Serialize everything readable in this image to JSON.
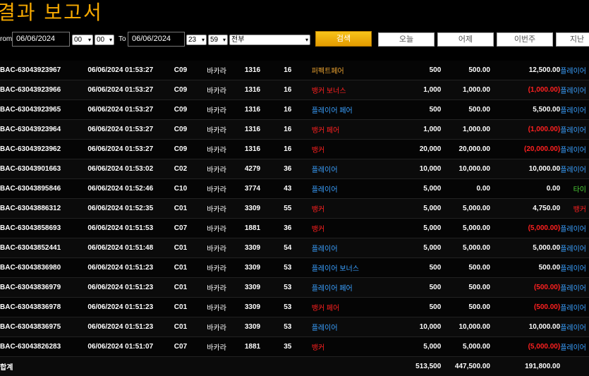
{
  "page": {
    "title": "결과 보고서"
  },
  "filters": {
    "from_label": "rom",
    "from_date": "06/06/2024",
    "from_hour": "00",
    "from_minute": "00",
    "to_label": "To",
    "to_date": "06/06/2024",
    "to_hour": "23",
    "to_minute": "59",
    "type_select": "전부",
    "search_label": "검색",
    "quick": [
      "오늘",
      "어제",
      "이번주",
      "지난"
    ]
  },
  "colors": {
    "orange": "#e8a030",
    "red": "#ff2020",
    "blue": "#3aa0ff",
    "green": "#4cd137",
    "title": "#f5a800"
  },
  "rows": [
    {
      "id": "BAC-63043923967",
      "time": "06/06/2024 01:53:27",
      "table": "C09",
      "game": "바카라",
      "shoe": "1316",
      "round": "16",
      "bet": "퍼펙트페어",
      "bet_color": "orange",
      "amount": "500",
      "valid": "500.00",
      "winloss": "12,500.00",
      "wl_color": "white",
      "result": "플레이어",
      "res_color": "blue"
    },
    {
      "id": "BAC-63043923966",
      "time": "06/06/2024 01:53:27",
      "table": "C09",
      "game": "바카라",
      "shoe": "1316",
      "round": "16",
      "bet": "뱅커 보너스",
      "bet_color": "red",
      "amount": "1,000",
      "valid": "1,000.00",
      "winloss": "(1,000.00)",
      "wl_color": "red",
      "result": "플레이어",
      "res_color": "blue"
    },
    {
      "id": "BAC-63043923965",
      "time": "06/06/2024 01:53:27",
      "table": "C09",
      "game": "바카라",
      "shoe": "1316",
      "round": "16",
      "bet": "플레이어 페어",
      "bet_color": "blue",
      "amount": "500",
      "valid": "500.00",
      "winloss": "5,500.00",
      "wl_color": "white",
      "result": "플레이어",
      "res_color": "blue"
    },
    {
      "id": "BAC-63043923964",
      "time": "06/06/2024 01:53:27",
      "table": "C09",
      "game": "바카라",
      "shoe": "1316",
      "round": "16",
      "bet": "뱅커 페어",
      "bet_color": "red",
      "amount": "1,000",
      "valid": "1,000.00",
      "winloss": "(1,000.00)",
      "wl_color": "red",
      "result": "플레이어",
      "res_color": "blue"
    },
    {
      "id": "BAC-63043923962",
      "time": "06/06/2024 01:53:27",
      "table": "C09",
      "game": "바카라",
      "shoe": "1316",
      "round": "16",
      "bet": "뱅커",
      "bet_color": "red",
      "amount": "20,000",
      "valid": "20,000.00",
      "winloss": "(20,000.00)",
      "wl_color": "red",
      "result": "플레이어",
      "res_color": "blue"
    },
    {
      "id": "BAC-63043901663",
      "time": "06/06/2024 01:53:02",
      "table": "C02",
      "game": "바카라",
      "shoe": "4279",
      "round": "36",
      "bet": "플레이어",
      "bet_color": "blue",
      "amount": "10,000",
      "valid": "10,000.00",
      "winloss": "10,000.00",
      "wl_color": "white",
      "result": "플레이어",
      "res_color": "blue"
    },
    {
      "id": "BAC-63043895846",
      "time": "06/06/2024 01:52:46",
      "table": "C10",
      "game": "바카라",
      "shoe": "3774",
      "round": "43",
      "bet": "플레이어",
      "bet_color": "blue",
      "amount": "5,000",
      "valid": "0.00",
      "winloss": "0.00",
      "wl_color": "white",
      "result": "타이",
      "res_color": "green"
    },
    {
      "id": "BAC-63043886312",
      "time": "06/06/2024 01:52:35",
      "table": "C01",
      "game": "바카라",
      "shoe": "3309",
      "round": "55",
      "bet": "뱅커",
      "bet_color": "red",
      "amount": "5,000",
      "valid": "5,000.00",
      "winloss": "4,750.00",
      "wl_color": "white",
      "result": "뱅커",
      "res_color": "red"
    },
    {
      "id": "BAC-63043858693",
      "time": "06/06/2024 01:51:53",
      "table": "C07",
      "game": "바카라",
      "shoe": "1881",
      "round": "36",
      "bet": "뱅커",
      "bet_color": "red",
      "amount": "5,000",
      "valid": "5,000.00",
      "winloss": "(5,000.00)",
      "wl_color": "red",
      "result": "플레이어",
      "res_color": "blue"
    },
    {
      "id": "BAC-63043852441",
      "time": "06/06/2024 01:51:48",
      "table": "C01",
      "game": "바카라",
      "shoe": "3309",
      "round": "54",
      "bet": "플레이어",
      "bet_color": "blue",
      "amount": "5,000",
      "valid": "5,000.00",
      "winloss": "5,000.00",
      "wl_color": "white",
      "result": "플레이어",
      "res_color": "blue"
    },
    {
      "id": "BAC-63043836980",
      "time": "06/06/2024 01:51:23",
      "table": "C01",
      "game": "바카라",
      "shoe": "3309",
      "round": "53",
      "bet": "플레이어 보너스",
      "bet_color": "blue",
      "amount": "500",
      "valid": "500.00",
      "winloss": "500.00",
      "wl_color": "white",
      "result": "플레이어",
      "res_color": "blue"
    },
    {
      "id": "BAC-63043836979",
      "time": "06/06/2024 01:51:23",
      "table": "C01",
      "game": "바카라",
      "shoe": "3309",
      "round": "53",
      "bet": "플레이어 페어",
      "bet_color": "blue",
      "amount": "500",
      "valid": "500.00",
      "winloss": "(500.00)",
      "wl_color": "red",
      "result": "플레이어",
      "res_color": "blue"
    },
    {
      "id": "BAC-63043836978",
      "time": "06/06/2024 01:51:23",
      "table": "C01",
      "game": "바카라",
      "shoe": "3309",
      "round": "53",
      "bet": "뱅커 페어",
      "bet_color": "red",
      "amount": "500",
      "valid": "500.00",
      "winloss": "(500.00)",
      "wl_color": "red",
      "result": "플레이어",
      "res_color": "blue"
    },
    {
      "id": "BAC-63043836975",
      "time": "06/06/2024 01:51:23",
      "table": "C01",
      "game": "바카라",
      "shoe": "3309",
      "round": "53",
      "bet": "플레이어",
      "bet_color": "blue",
      "amount": "10,000",
      "valid": "10,000.00",
      "winloss": "10,000.00",
      "wl_color": "white",
      "result": "플레이어",
      "res_color": "blue"
    },
    {
      "id": "BAC-63043826283",
      "time": "06/06/2024 01:51:07",
      "table": "C07",
      "game": "바카라",
      "shoe": "1881",
      "round": "35",
      "bet": "뱅커",
      "bet_color": "red",
      "amount": "5,000",
      "valid": "5,000.00",
      "winloss": "(5,000.00)",
      "wl_color": "red",
      "result": "플레이어",
      "res_color": "blue"
    }
  ],
  "summary": {
    "label": "합계",
    "amount": "513,500",
    "valid": "447,500.00",
    "winloss": "191,800.00"
  }
}
